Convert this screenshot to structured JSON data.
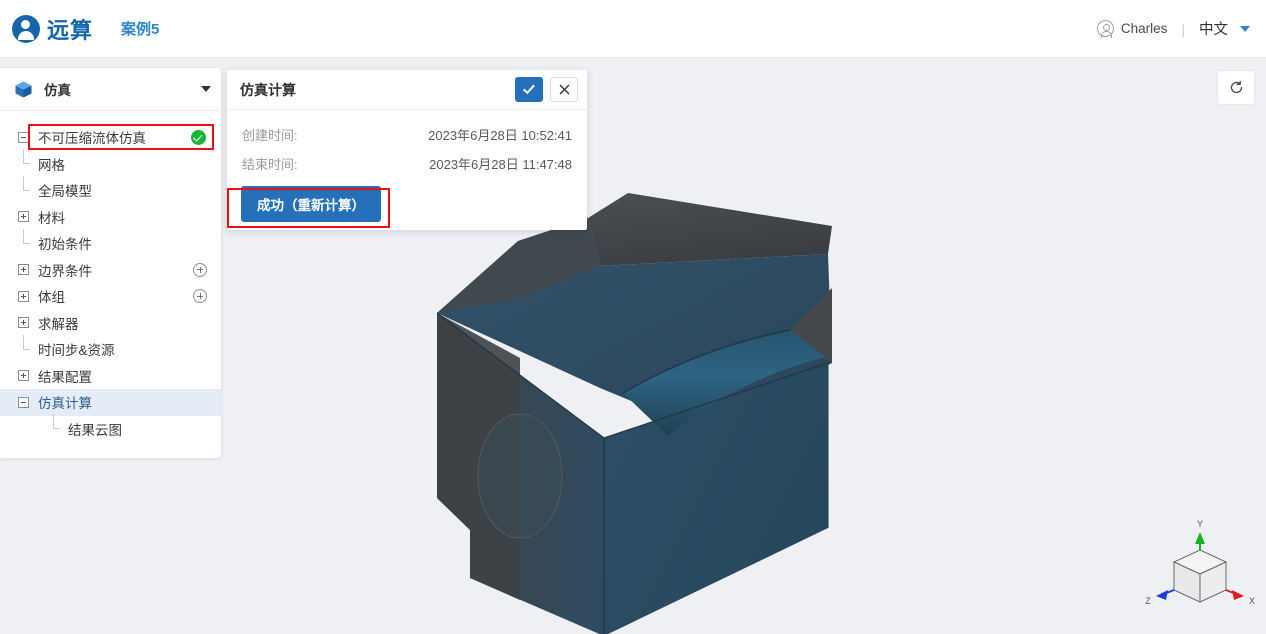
{
  "header": {
    "brand_name": "远算",
    "project_name": "案例5",
    "user_name": "Charles",
    "separator": "|",
    "language": "中文",
    "icons": {
      "logo": "yuansuan-logo-icon",
      "user": "user-avatar-icon",
      "caret": "chevron-down-icon"
    }
  },
  "sidebar": {
    "title": "仿真",
    "icon": "cube-icon",
    "tree": [
      {
        "label": "不可压缩流体仿真",
        "toggle": "minus",
        "indent": 0,
        "status": "success",
        "highlighted": true
      },
      {
        "label": "网格",
        "toggle": "leaf",
        "indent": 0
      },
      {
        "label": "全局模型",
        "toggle": "leaf",
        "indent": 0
      },
      {
        "label": "材料",
        "toggle": "plus",
        "indent": 0
      },
      {
        "label": "初始条件",
        "toggle": "leaf",
        "indent": 0
      },
      {
        "label": "边界条件",
        "toggle": "plus",
        "indent": 0,
        "action": "add"
      },
      {
        "label": "体组",
        "toggle": "plus",
        "indent": 0,
        "action": "add"
      },
      {
        "label": "求解器",
        "toggle": "plus",
        "indent": 0
      },
      {
        "label": "时间步&资源",
        "toggle": "leaf",
        "indent": 0
      },
      {
        "label": "结果配置",
        "toggle": "plus",
        "indent": 0
      },
      {
        "label": "仿真计算",
        "toggle": "minus",
        "indent": 0,
        "selected": true
      },
      {
        "label": "结果云图",
        "toggle": "leaf",
        "indent": 1
      }
    ]
  },
  "dialog": {
    "title": "仿真计算",
    "confirm_icon": "check-icon",
    "close_icon": "close-icon",
    "rows": [
      {
        "key": "创建时间:",
        "value": "2023年6月28日 10:52:41"
      },
      {
        "key": "结束时间:",
        "value": "2023年6月28日 11:47:48"
      }
    ],
    "action_button": "成功（重新计算）"
  },
  "viewport": {
    "reset_button_icon": "refresh-icon",
    "axis_labels": {
      "x": "X",
      "y": "Y",
      "z": "Z"
    },
    "model_name": "cfd-geometry-model"
  },
  "colors": {
    "brand_blue": "#1565a8",
    "accent_blue": "#2570b8",
    "success_green": "#19b634",
    "highlight_red": "#ee1010",
    "selection_blue": "#e4edf7",
    "canvas_bg": "#eef0f4",
    "model_face": "#2e4d63",
    "model_dark": "#43474b",
    "axis_x": "#e01b1b",
    "axis_y": "#17b317",
    "axis_z": "#1b3ce0"
  }
}
